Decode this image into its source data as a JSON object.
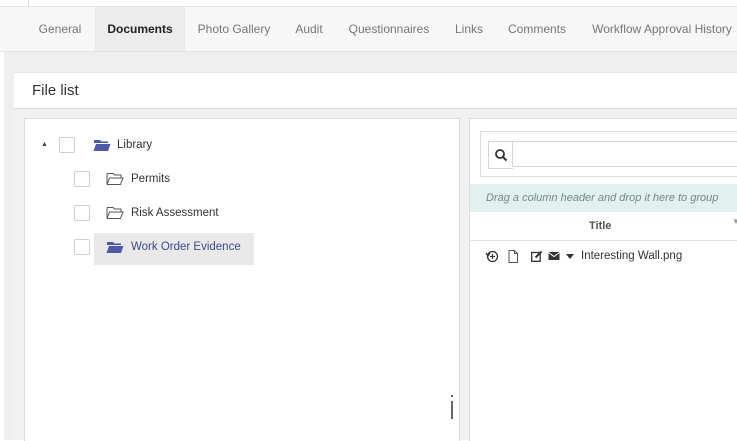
{
  "tabs": [
    {
      "label": "General",
      "active": false
    },
    {
      "label": "Documents",
      "active": true
    },
    {
      "label": "Photo Gallery",
      "active": false
    },
    {
      "label": "Audit",
      "active": false
    },
    {
      "label": "Questionnaires",
      "active": false
    },
    {
      "label": "Links",
      "active": false
    },
    {
      "label": "Comments",
      "active": false
    },
    {
      "label": "Workflow Approval History",
      "active": false
    }
  ],
  "file_list": {
    "title": "File list",
    "tree": {
      "root": {
        "label": "Library",
        "expanded": true,
        "icon": "folder-open-icon"
      },
      "children": [
        {
          "label": "Permits",
          "icon": "folder-outline-icon",
          "selected": false
        },
        {
          "label": "Risk Assessment",
          "icon": "folder-outline-icon",
          "selected": false
        },
        {
          "label": "Work Order Evidence",
          "icon": "folder-open-icon",
          "selected": true
        }
      ]
    }
  },
  "grid": {
    "search": {
      "placeholder": "",
      "value": ""
    },
    "group_hint": "Drag a column header and drop it here to group",
    "columns": [
      {
        "title": "Title"
      }
    ],
    "rows": [
      {
        "title": "Interesting Wall.png"
      }
    ]
  },
  "colors": {
    "active_tab_bg": "#ececec",
    "selected_node_text": "#3e4a8a",
    "group_bar_bg": "#e3f0f0"
  }
}
